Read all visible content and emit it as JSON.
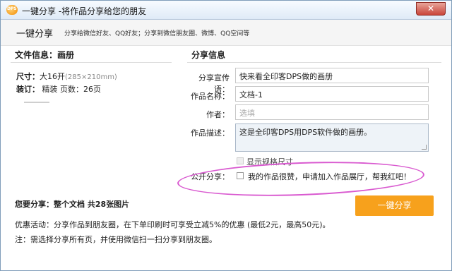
{
  "window": {
    "title": "一键分享 -将作品分享给您的朋友",
    "app_icon_text": "DPS",
    "close_symbol": "✕"
  },
  "header": {
    "title": "一键分享",
    "subtitle": "分享给微信好友、QQ好友；分享到微信朋友圈、微博、QQ空间等"
  },
  "file_info": {
    "title": "文件信息：画册",
    "size_label": "尺寸：",
    "size_value": "大16开",
    "size_detail": "(285×210mm)",
    "binding_label": "装订：",
    "binding_value": "精装",
    "pages_label": "页数：",
    "pages_value": "26页"
  },
  "share_info": {
    "title": "分享信息",
    "slogan_label": "分享宣传语：",
    "slogan_value": "快来看全印客DPS做的画册",
    "name_label": "作品名称：",
    "name_value": "文档-1",
    "author_label": "作者：",
    "author_placeholder": "选填",
    "desc_label": "作品描述：",
    "desc_value": "这是全印客DPS用DPS软件做的画册。",
    "show_size_label": "显示规格尺寸",
    "public_label": "公开分享：",
    "public_text": "我的作品很赞，申请加入作品展厅，帮我红吧！"
  },
  "share_summary": "您要分享：整个文档 共28张图片",
  "share_button": "一键分享",
  "promo": "优惠活动：分享作品到朋友圈，在下单印刷时可享受立减5%的优惠 (最低2元，最高50元)。",
  "note": "注：需选择分享所有页，并使用微信扫一扫分享到朋友圈。",
  "colors": {
    "accent_button": "#f7a11c",
    "highlight_oval": "#d95ad0"
  }
}
